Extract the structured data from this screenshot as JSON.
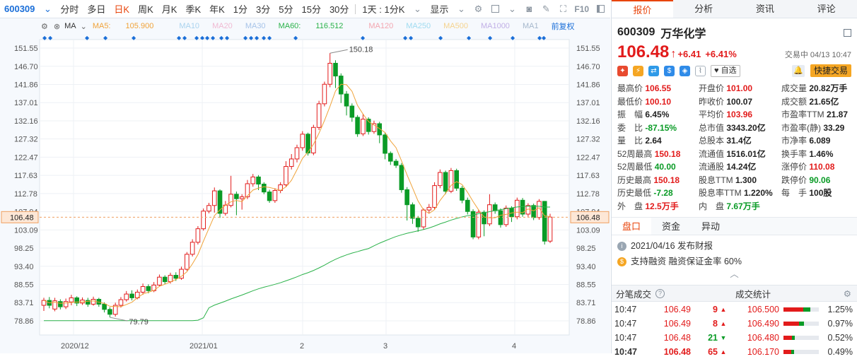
{
  "toolbar": {
    "code": "600309",
    "items": [
      "分时",
      "多日",
      "日K",
      "周K",
      "月K",
      "季K",
      "年K",
      "1分",
      "3分",
      "5分",
      "15分",
      "30分"
    ],
    "active": "日K",
    "range": "1天 : 1分K",
    "display": "显示",
    "f10": "F10"
  },
  "ma_legend": {
    "ma5_label": "MA5: ",
    "ma5_value": "105.900",
    "ma10": "MA10",
    "ma20": "MA20",
    "ma30": "MA30",
    "ma60_label": "MA60: ",
    "ma60_value": "116.512",
    "ma120": "MA120",
    "ma250": "MA250",
    "ma500": "MA500",
    "ma1000": "MA1000",
    "ma1": "MA1",
    "fq": "前复权",
    "ma": "MA"
  },
  "colors": {
    "up": "#e21b1b",
    "down": "#0a9b26",
    "ma5": "#f0a33a",
    "ma60": "#2bb24a",
    "accent": "#e8450c"
  },
  "chart_data": {
    "type": "candlestick",
    "y_ticks": [
      "151.55",
      "146.70",
      "141.86",
      "137.01",
      "132.16",
      "127.32",
      "122.47",
      "117.63",
      "112.78",
      "107.94",
      "103.09",
      "98.25",
      "93.40",
      "88.55",
      "83.71",
      "78.86"
    ],
    "current_price": "106.48",
    "x_labels": [
      "2020/12",
      "2021/01",
      "2",
      "3",
      "4"
    ],
    "high_label": "150.18",
    "low_label": "79.79",
    "candles": [
      [
        83.0,
        84.3,
        81.5,
        85.0
      ],
      [
        84.3,
        83.0,
        82.2,
        85.2
      ],
      [
        82.0,
        84.2,
        81.4,
        85.0
      ],
      [
        84.0,
        82.6,
        81.9,
        84.6
      ],
      [
        82.6,
        84.0,
        82.0,
        84.8
      ],
      [
        83.9,
        85.0,
        83.0,
        85.8
      ],
      [
        85.0,
        83.6,
        82.8,
        85.4
      ],
      [
        83.6,
        84.4,
        83.1,
        85.1
      ],
      [
        84.3,
        83.3,
        82.6,
        85.0
      ],
      [
        83.3,
        84.6,
        82.9,
        85.3
      ],
      [
        84.6,
        83.3,
        82.6,
        85.0
      ],
      [
        83.3,
        81.9,
        81.1,
        83.8
      ],
      [
        81.9,
        80.6,
        79.8,
        82.5
      ],
      [
        80.6,
        83.0,
        80.0,
        83.7
      ],
      [
        83.0,
        84.5,
        82.4,
        85.2
      ],
      [
        84.5,
        86.0,
        84.0,
        86.8
      ],
      [
        86.0,
        85.0,
        84.3,
        87.0
      ],
      [
        85.0,
        86.5,
        84.6,
        87.2
      ],
      [
        86.5,
        88.0,
        85.8,
        88.8
      ],
      [
        88.0,
        86.9,
        86.2,
        88.6
      ],
      [
        86.9,
        88.4,
        86.5,
        89.2
      ],
      [
        88.4,
        90.5,
        88.0,
        91.2
      ],
      [
        90.5,
        89.3,
        88.6,
        91.0
      ],
      [
        89.3,
        91.0,
        88.8,
        91.7
      ],
      [
        91.0,
        90.2,
        89.5,
        91.8
      ],
      [
        90.2,
        92.6,
        89.8,
        93.3
      ],
      [
        92.6,
        96.6,
        92.2,
        97.2
      ],
      [
        96.6,
        99.8,
        96.0,
        100.6
      ],
      [
        99.8,
        103.4,
        99.2,
        104.1
      ],
      [
        103.4,
        108.1,
        102.9,
        108.8
      ],
      [
        108.1,
        109.6,
        107.5,
        110.3
      ],
      [
        109.6,
        113.5,
        107.7,
        114.4
      ],
      [
        113.5,
        107.5,
        106.3,
        113.9
      ],
      [
        107.5,
        109.7,
        106.9,
        110.8
      ],
      [
        109.6,
        112.6,
        109.1,
        117.5
      ],
      [
        112.6,
        111.4,
        107.0,
        113.3
      ],
      [
        111.4,
        111.9,
        108.5,
        112.6
      ],
      [
        111.9,
        115.4,
        111.3,
        116.4
      ],
      [
        115.4,
        117.2,
        114.6,
        118.0
      ],
      [
        117.2,
        115.3,
        113.7,
        117.7
      ],
      [
        115.3,
        113.2,
        112.6,
        115.8
      ],
      [
        113.2,
        110.9,
        110.3,
        113.8
      ],
      [
        110.9,
        113.6,
        110.3,
        114.2
      ],
      [
        113.6,
        115.1,
        112.9,
        115.8
      ],
      [
        115.1,
        120.0,
        114.5,
        121.4
      ],
      [
        120.0,
        122.0,
        119.2,
        123.3
      ],
      [
        122.0,
        125.0,
        121.1,
        125.8
      ],
      [
        125.0,
        128.6,
        124.2,
        129.4
      ],
      [
        128.6,
        123.6,
        122.9,
        129.0
      ],
      [
        123.6,
        130.4,
        123.0,
        131.1
      ],
      [
        130.4,
        136.7,
        129.7,
        137.5
      ],
      [
        136.7,
        141.9,
        136.0,
        142.6
      ],
      [
        141.9,
        147.5,
        141.1,
        150.2
      ],
      [
        147.5,
        144.1,
        140.9,
        148.3
      ],
      [
        144.1,
        139.3,
        136.9,
        144.8
      ],
      [
        139.3,
        136.1,
        133.6,
        140.1
      ],
      [
        136.1,
        133.1,
        131.9,
        136.8
      ],
      [
        133.1,
        128.7,
        127.9,
        133.7
      ],
      [
        128.7,
        132.6,
        128.1,
        134.0
      ],
      [
        132.6,
        129.3,
        128.5,
        133.1
      ],
      [
        129.3,
        131.4,
        128.7,
        132.2
      ],
      [
        131.4,
        128.4,
        126.2,
        131.9
      ],
      [
        128.4,
        123.5,
        121.9,
        128.9
      ],
      [
        123.5,
        121.4,
        120.4,
        124.0
      ],
      [
        121.4,
        120.3,
        119.6,
        122.0
      ],
      [
        120.3,
        113.8,
        113.0,
        120.9
      ],
      [
        113.8,
        109.8,
        105.6,
        114.5
      ],
      [
        109.8,
        106.2,
        104.7,
        110.4
      ],
      [
        106.2,
        103.9,
        102.6,
        106.8
      ],
      [
        103.9,
        108.4,
        103.2,
        108.8
      ],
      [
        108.4,
        109.1,
        107.6,
        110.0
      ],
      [
        109.1,
        114.9,
        108.5,
        115.8
      ],
      [
        114.9,
        118.4,
        114.2,
        119.2
      ],
      [
        118.4,
        113.4,
        112.6,
        118.9
      ],
      [
        113.4,
        118.9,
        112.9,
        119.6
      ],
      [
        118.9,
        114.2,
        113.5,
        119.4
      ],
      [
        114.2,
        111.0,
        110.2,
        114.8
      ],
      [
        111.0,
        108.0,
        107.2,
        111.7
      ],
      [
        108.0,
        101.2,
        100.6,
        108.6
      ],
      [
        101.2,
        107.8,
        100.6,
        108.5
      ],
      [
        107.8,
        104.7,
        101.4,
        108.3
      ],
      [
        104.7,
        109.8,
        104.1,
        112.6
      ],
      [
        109.8,
        108.2,
        107.4,
        110.4
      ],
      [
        108.2,
        104.5,
        103.7,
        108.8
      ],
      [
        104.5,
        108.9,
        103.9,
        109.6
      ],
      [
        108.9,
        106.6,
        105.2,
        109.4
      ],
      [
        106.6,
        111.0,
        105.9,
        111.7
      ],
      [
        111.0,
        107.3,
        106.6,
        111.6
      ],
      [
        107.3,
        109.6,
        106.6,
        110.2
      ],
      [
        109.6,
        106.4,
        105.7,
        110.1
      ],
      [
        106.4,
        110.7,
        105.8,
        111.3
      ],
      [
        110.7,
        100.1,
        99.2,
        110.8
      ],
      [
        100.1,
        106.5,
        99.6,
        107.4
      ]
    ]
  },
  "quote": {
    "code": "600309",
    "name": "万华化学",
    "price": "106.48",
    "arrow": "↑",
    "change": "+6.41",
    "pct": "+6.41%",
    "status": "交易中 04/13 10:47",
    "fav": "自选",
    "quick": "快捷交易"
  },
  "tabs": [
    "报价",
    "分析",
    "资讯",
    "评论"
  ],
  "fields": [
    [
      "最高价",
      "106.55",
      "red"
    ],
    [
      "开盘价",
      "101.00",
      "red"
    ],
    [
      "成交量",
      "20.82万手",
      "blk"
    ],
    [
      "最低价",
      "100.10",
      "red"
    ],
    [
      "昨收价",
      "100.07",
      "blk"
    ],
    [
      "成交额",
      "21.65亿",
      "blk"
    ],
    [
      "振　幅",
      "6.45%",
      "blk"
    ],
    [
      "平均价",
      "103.96",
      "red"
    ],
    [
      "市盈率TTM",
      "21.87",
      "blk"
    ],
    [
      "委　比",
      "-87.15%",
      "green"
    ],
    [
      "总市值",
      "3343.20亿",
      "blk"
    ],
    [
      "市盈率(静)",
      "33.29",
      "blk"
    ],
    [
      "量　比",
      "2.64",
      "blk"
    ],
    [
      "总股本",
      "31.4亿",
      "blk"
    ],
    [
      "市净率",
      "6.089",
      "blk"
    ],
    [
      "52周最高",
      "150.18",
      "red"
    ],
    [
      "流通值",
      "1516.01亿",
      "blk"
    ],
    [
      "换手率",
      "1.46%",
      "blk"
    ],
    [
      "52周最低",
      "40.00",
      "green"
    ],
    [
      "流通股",
      "14.24亿",
      "blk"
    ],
    [
      "涨停价",
      "110.08",
      "red"
    ],
    [
      "历史最高",
      "150.18",
      "red"
    ],
    [
      "股息TTM",
      "1.300",
      "blk"
    ],
    [
      "跌停价",
      "90.06",
      "green"
    ],
    [
      "历史最低",
      "-7.28",
      "green"
    ],
    [
      "股息率TTM",
      "1.220%",
      "blk"
    ],
    [
      "每　手",
      "100股",
      "blk"
    ],
    [
      "外　盘",
      "12.5万手",
      "red"
    ],
    [
      "内　盘",
      "7.67万手",
      "green"
    ]
  ],
  "subtabs": [
    "盘口",
    "资金",
    "异动"
  ],
  "news": [
    {
      "text": "2021/04/16  发布财报"
    },
    {
      "text": "支持融资  融资保证金率 60%"
    }
  ],
  "trades_title": "分笔成交",
  "stats_title": "成交统计",
  "trades": [
    [
      "10:47",
      "106.49",
      "9",
      "▲"
    ],
    [
      "10:47",
      "106.49",
      "8",
      "▲"
    ],
    [
      "10:47",
      "106.48",
      "21",
      "▼"
    ],
    [
      "10:47",
      "106.48",
      "65",
      "▲"
    ]
  ],
  "stats": [
    [
      "106.500",
      "1.25%"
    ],
    [
      "106.490",
      "0.97%"
    ],
    [
      "106.480",
      "0.52%"
    ],
    [
      "106.170",
      "0.49%"
    ]
  ]
}
